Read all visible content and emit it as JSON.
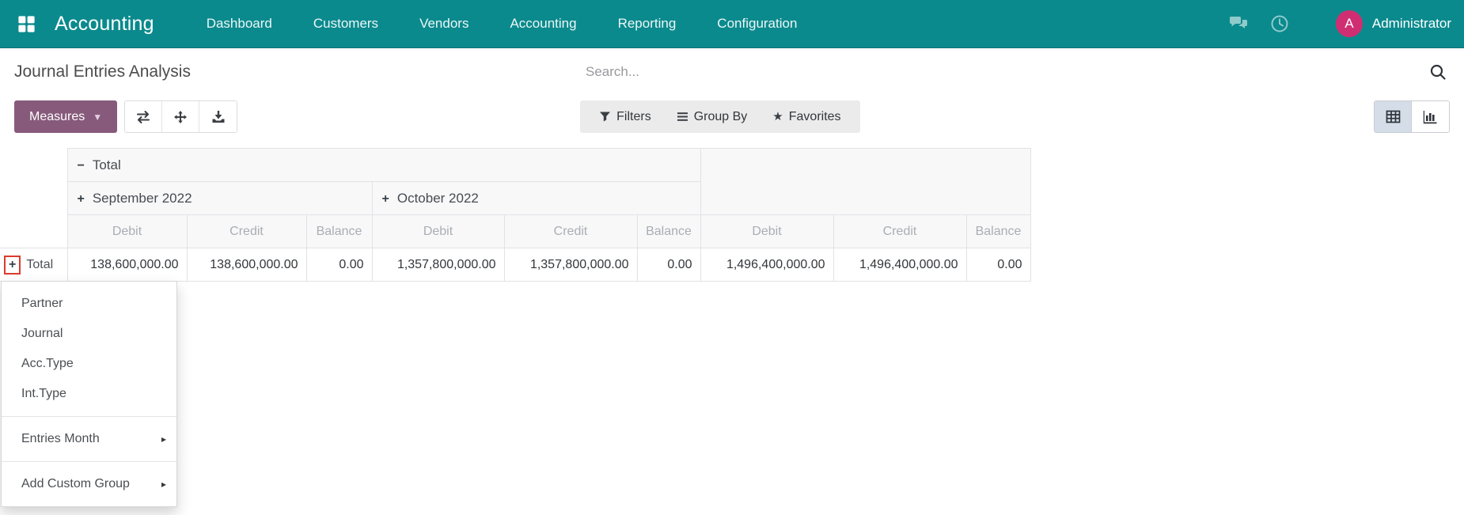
{
  "colors": {
    "navbar": "#0b8a8d",
    "primary_button": "#875a7b",
    "avatar": "#d02e72",
    "highlight_red": "#dc3b2c",
    "view_active_bg": "#d4dde8"
  },
  "navbar": {
    "brand": "Accounting",
    "menu_items": [
      "Dashboard",
      "Customers",
      "Vendors",
      "Accounting",
      "Reporting",
      "Configuration"
    ],
    "user": {
      "initial": "A",
      "name": "Administrator"
    }
  },
  "control_panel": {
    "title": "Journal Entries Analysis",
    "search_placeholder": "Search..."
  },
  "toolbar": {
    "measures_label": "Measures",
    "filters_label": "Filters",
    "group_by_label": "Group By",
    "favorites_label": "Favorites"
  },
  "icons": {
    "caret_down": "▼",
    "submenu_arrow": "▸"
  },
  "pivot": {
    "top_group": {
      "toggle": "−",
      "label": "Total"
    },
    "column_groups": [
      {
        "toggle": "+",
        "label": "September 2022"
      },
      {
        "toggle": "+",
        "label": "October 2022"
      }
    ],
    "measures": [
      "Debit",
      "Credit",
      "Balance"
    ],
    "row": {
      "toggle": "+",
      "label": "Total",
      "values": [
        "138,600,000.00",
        "138,600,000.00",
        "0.00",
        "1,357,800,000.00",
        "1,357,800,000.00",
        "0.00",
        "1,496,400,000.00",
        "1,496,400,000.00",
        "0.00"
      ]
    }
  },
  "groupby_menu": {
    "items": [
      "Partner",
      "Journal",
      "Acc.Type",
      "Int.Type"
    ],
    "submenus": [
      {
        "label": "Entries Month"
      },
      {
        "label": "Add Custom Group"
      }
    ]
  }
}
